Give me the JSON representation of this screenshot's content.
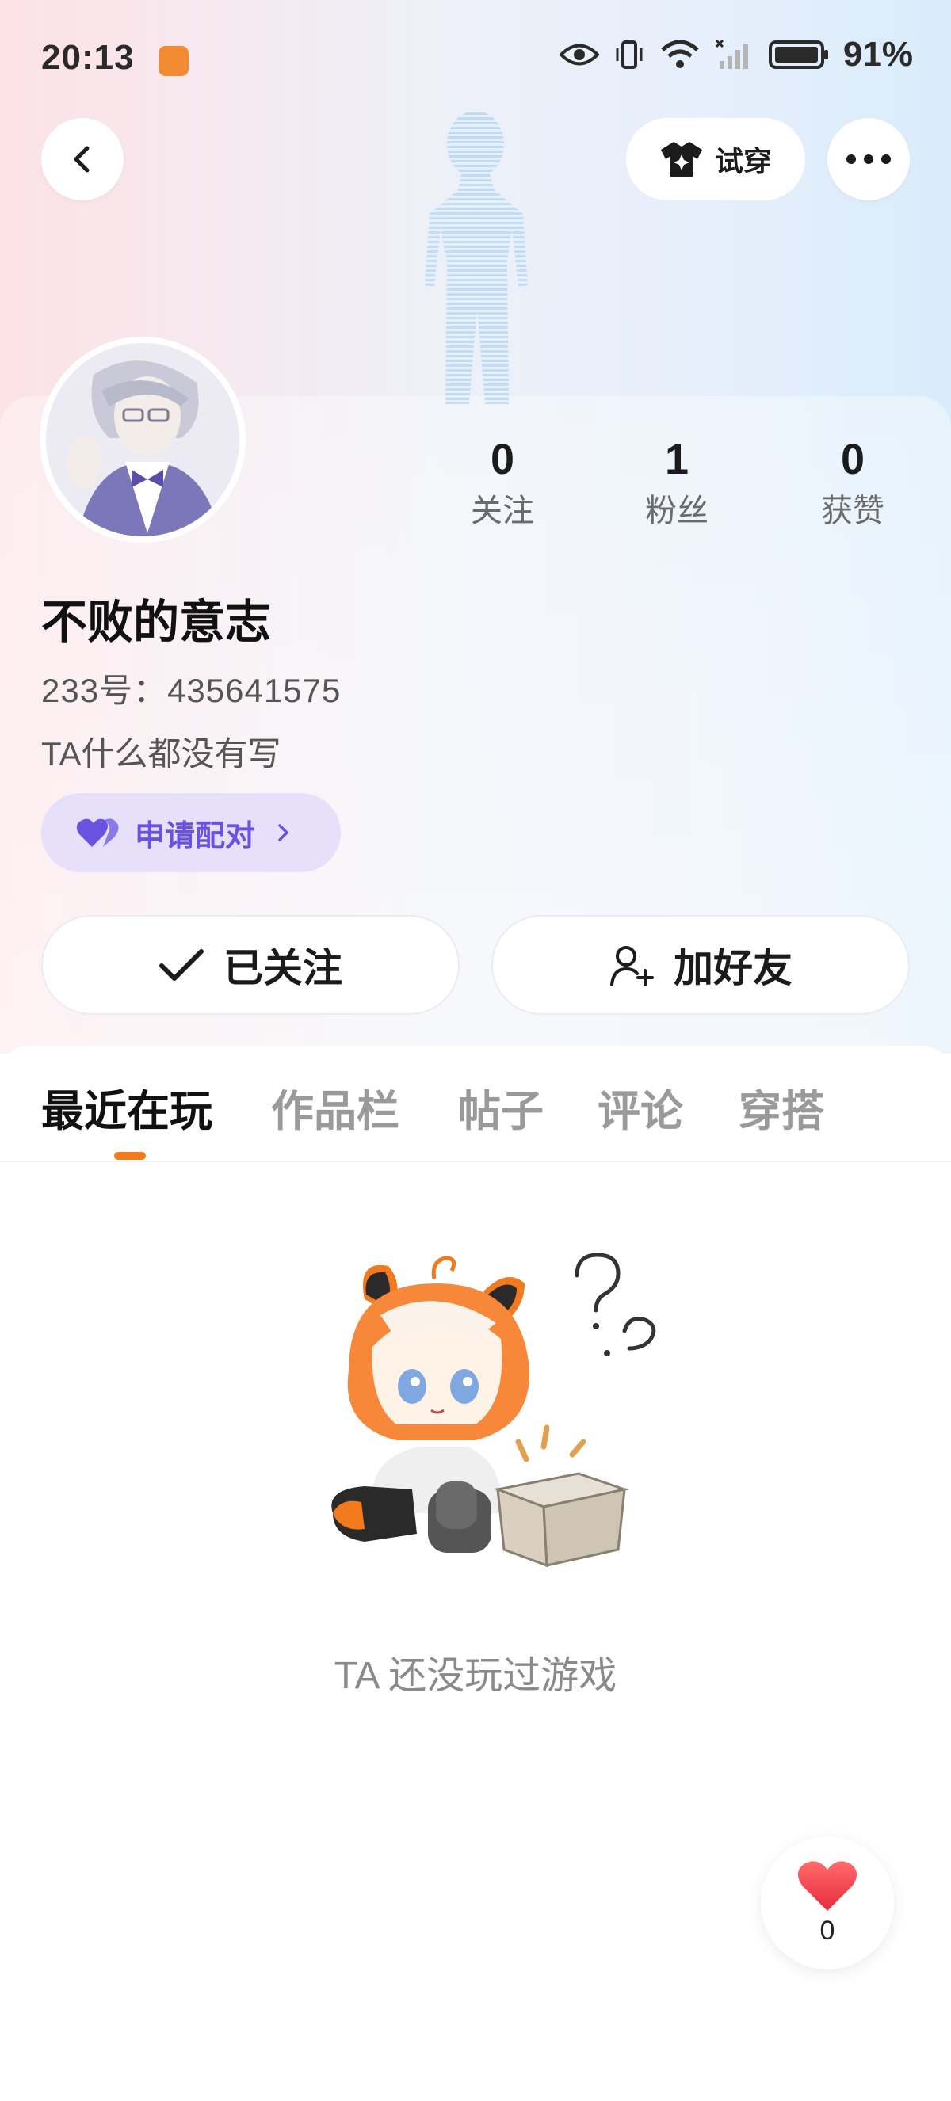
{
  "status_bar": {
    "time": "20:13",
    "battery": "91%"
  },
  "header": {
    "tryon_label": "试穿"
  },
  "profile": {
    "name": "不败的意志",
    "uid": "233号：435641575",
    "bio": "TA什么都没有写",
    "pair_label": "申请配对"
  },
  "stats": [
    {
      "value": "0",
      "label": "关注"
    },
    {
      "value": "1",
      "label": "粉丝"
    },
    {
      "value": "0",
      "label": "获赞"
    }
  ],
  "actions": {
    "followed_label": "已关注",
    "add_friend_label": "加好友"
  },
  "tabs": [
    {
      "label": "最近在玩",
      "active": true
    },
    {
      "label": "作品栏"
    },
    {
      "label": "帖子"
    },
    {
      "label": "评论"
    },
    {
      "label": "穿搭"
    }
  ],
  "empty_state": {
    "message": "TA 还没玩过游戏"
  },
  "like": {
    "count": "0"
  },
  "colors": {
    "accent": "#f07a1d",
    "pair_purple": "#6a52e0",
    "like_red": "#f0434f"
  }
}
